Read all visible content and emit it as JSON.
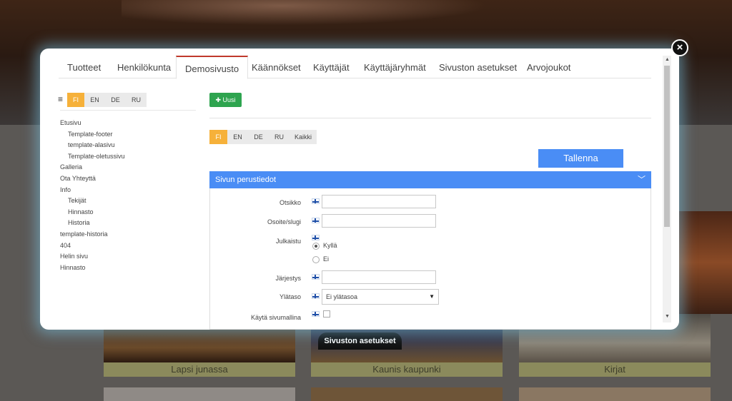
{
  "background": {
    "tiles": [
      {
        "caption": "Lapsi junassa"
      },
      {
        "caption": "Kaunis kaupunki"
      },
      {
        "caption": "Kirjat"
      }
    ],
    "settings_button": "Sivuston asetukset"
  },
  "modal": {
    "close_icon": "×",
    "tabs": [
      {
        "label": "Tuotteet"
      },
      {
        "label": "Henkilökunta"
      },
      {
        "label": "Demosivusto"
      },
      {
        "label": "Käännökset"
      },
      {
        "label": "Käyttäjät"
      },
      {
        "label": "Käyttäjäryhmät"
      },
      {
        "label": "Sivuston asetukset"
      },
      {
        "label": "Arvojoukot"
      }
    ],
    "active_tab": "Demosivusto"
  },
  "sidebar": {
    "menu_icon": "≡",
    "languages": [
      "FI",
      "EN",
      "DE",
      "RU"
    ],
    "active_language": "FI",
    "tree": [
      {
        "label": "Etusivu"
      },
      {
        "label": "Template-footer"
      },
      {
        "label": "template-alasivu"
      },
      {
        "label": "Template-oletussivu"
      },
      {
        "label": "Galleria"
      },
      {
        "label": "Ota Yhteyttä"
      },
      {
        "label": "Info"
      },
      {
        "label": "Tekijät"
      },
      {
        "label": "Hinnasto"
      },
      {
        "label": "Historia"
      },
      {
        "label": "template-historia"
      },
      {
        "label": "404"
      },
      {
        "label": "Helin sivu"
      },
      {
        "label": "Hinnasto"
      }
    ]
  },
  "content": {
    "new_button": "✚ Uusi",
    "languages": [
      "FI",
      "EN",
      "DE",
      "RU",
      "Kaikki"
    ],
    "active_language": "FI",
    "save_button": "Tallenna",
    "panel": {
      "title": "Sivun perustiedot",
      "chevron": "﹀",
      "fields": {
        "title_label": "Otsikko",
        "title_value": "",
        "slug_label": "Osoite/slugi",
        "slug_value": "",
        "published_label": "Julkaistu",
        "published_yes": "Kyllä",
        "published_no": "Ei",
        "published_value": "Kyllä",
        "order_label": "Järjestys",
        "order_value": "",
        "parent_label": "Ylätaso",
        "parent_value": "Ei ylätasoa",
        "template_label": "Käytä sivumallina",
        "template_checked": false
      }
    }
  }
}
